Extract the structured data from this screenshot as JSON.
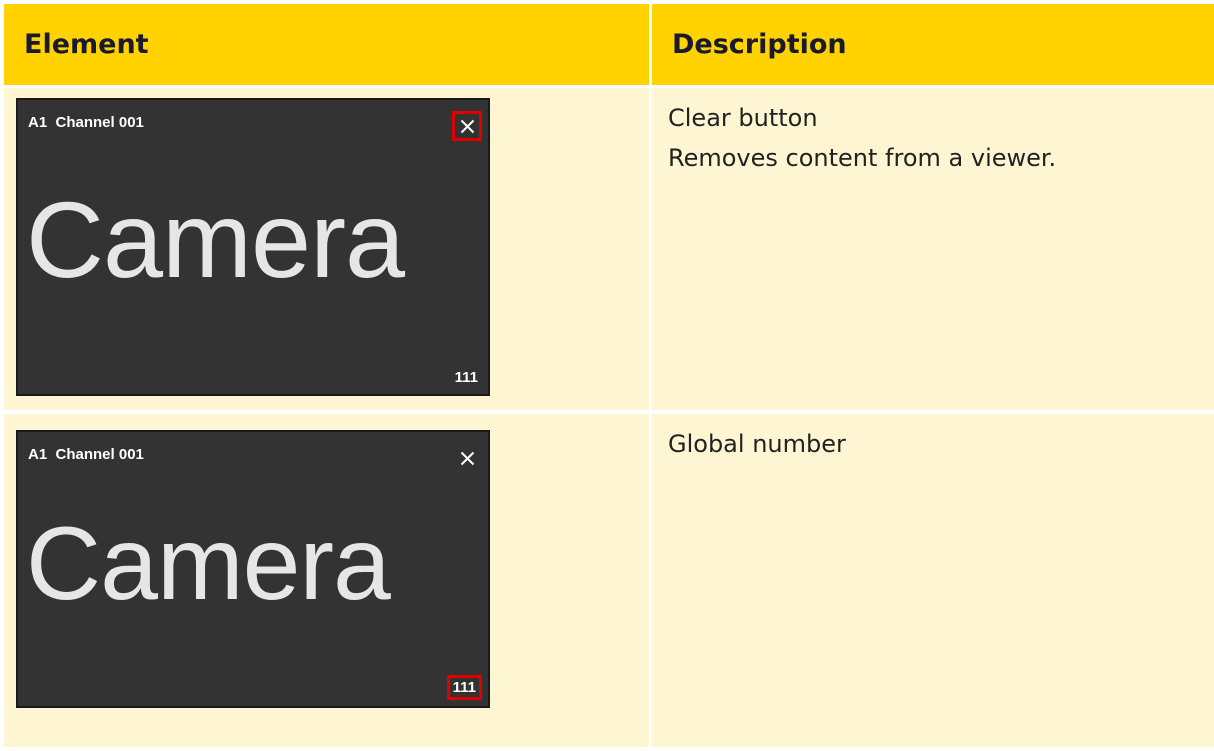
{
  "table": {
    "headers": {
      "element": "Element",
      "description": "Description"
    },
    "rows": [
      {
        "viewer": {
          "title": "A1  Channel 001",
          "content": "Camera",
          "global_number": "111",
          "highlight": "clear-button"
        },
        "description_lines": [
          "Clear button",
          "Removes content from a viewer."
        ]
      },
      {
        "viewer": {
          "title": "A1  Channel 001",
          "content": "Camera",
          "global_number": "111",
          "highlight": "global-number"
        },
        "description_lines": [
          "Global number"
        ]
      }
    ]
  },
  "colors": {
    "header_bg": "#ffd200",
    "row_bg": "#fef6d2",
    "viewer_bg": "#333333",
    "highlight": "#e00000"
  },
  "icons": {
    "clear": "close-icon"
  }
}
